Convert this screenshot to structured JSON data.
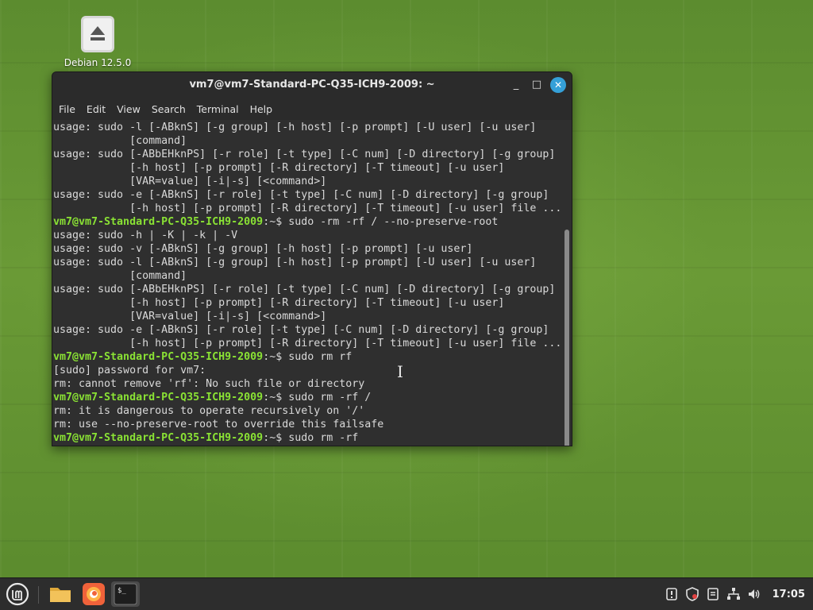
{
  "desktop": {
    "icon_label": "Debian 12.5.0"
  },
  "window": {
    "title": "vm7@vm7-Standard-PC-Q35-ICH9-2009: ~",
    "controls": {
      "minimize": "_",
      "maximize": "□",
      "close": "✕"
    }
  },
  "menu": {
    "items": [
      "File",
      "Edit",
      "View",
      "Search",
      "Terminal",
      "Help"
    ]
  },
  "terminal": {
    "prompt_user_host": "vm7@vm7-Standard-PC-Q35-ICH9-2009",
    "prompt_suffix": ":~",
    "lines": [
      {
        "type": "out",
        "text": "usage: sudo -l [-ABknS] [-g group] [-h host] [-p prompt] [-U user] [-u user]"
      },
      {
        "type": "out",
        "text": "            [command]"
      },
      {
        "type": "out",
        "text": "usage: sudo [-ABbEHknPS] [-r role] [-t type] [-C num] [-D directory] [-g group]"
      },
      {
        "type": "out",
        "text": "            [-h host] [-p prompt] [-R directory] [-T timeout] [-u user]"
      },
      {
        "type": "out",
        "text": "            [VAR=value] [-i|-s] [<command>]"
      },
      {
        "type": "out",
        "text": "usage: sudo -e [-ABknS] [-r role] [-t type] [-C num] [-D directory] [-g group]"
      },
      {
        "type": "out",
        "text": "            [-h host] [-p prompt] [-R directory] [-T timeout] [-u user] file ..."
      },
      {
        "type": "cmd",
        "text": "$ sudo -rm -rf / --no-preserve-root"
      },
      {
        "type": "out",
        "text": "usage: sudo -h | -K | -k | -V"
      },
      {
        "type": "out",
        "text": "usage: sudo -v [-ABknS] [-g group] [-h host] [-p prompt] [-u user]"
      },
      {
        "type": "out",
        "text": "usage: sudo -l [-ABknS] [-g group] [-h host] [-p prompt] [-U user] [-u user]"
      },
      {
        "type": "out",
        "text": "            [command]"
      },
      {
        "type": "out",
        "text": "usage: sudo [-ABbEHknPS] [-r role] [-t type] [-C num] [-D directory] [-g group]"
      },
      {
        "type": "out",
        "text": "            [-h host] [-p prompt] [-R directory] [-T timeout] [-u user]"
      },
      {
        "type": "out",
        "text": "            [VAR=value] [-i|-s] [<command>]"
      },
      {
        "type": "out",
        "text": "usage: sudo -e [-ABknS] [-r role] [-t type] [-C num] [-D directory] [-g group]"
      },
      {
        "type": "out",
        "text": "            [-h host] [-p prompt] [-R directory] [-T timeout] [-u user] file ..."
      },
      {
        "type": "cmd",
        "text": "$ sudo rm rf"
      },
      {
        "type": "out",
        "text": "[sudo] password for vm7:"
      },
      {
        "type": "out",
        "text": "rm: cannot remove 'rf': No such file or directory"
      },
      {
        "type": "cmd",
        "text": "$ sudo rm -rf /"
      },
      {
        "type": "out",
        "text": "rm: it is dangerous to operate recursively on '/'"
      },
      {
        "type": "out",
        "text": "rm: use --no-preserve-root to override this failsafe"
      },
      {
        "type": "cmd",
        "text": "$ sudo rm -rf"
      }
    ]
  },
  "taskbar": {
    "apps": [
      "menu-icon",
      "files-icon",
      "firefox-icon",
      "terminal-icon"
    ],
    "tray_icons": [
      "update-icon",
      "shield-icon",
      "clipboard-icon",
      "network-icon",
      "volume-icon"
    ],
    "clock": "17:05"
  },
  "colors": {
    "prompt_green": "#8ae234",
    "close_blue": "#35a0d8",
    "terminal_bg": "#2f2f2f"
  }
}
